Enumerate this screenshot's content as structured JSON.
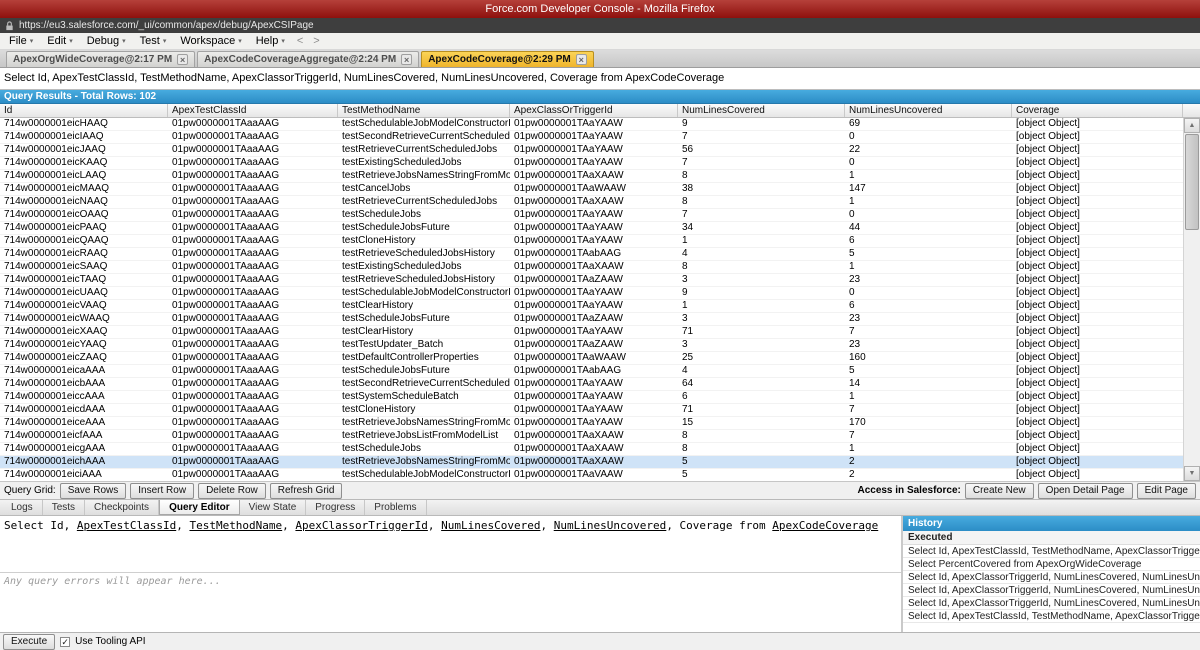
{
  "window": {
    "title": "Force.com Developer Console - Mozilla Firefox",
    "url": "https://eu3.salesforce.com/_ui/common/apex/debug/ApexCSIPage"
  },
  "menu": {
    "items": [
      "File",
      "Edit",
      "Debug",
      "Test",
      "Workspace",
      "Help"
    ],
    "back": "<",
    "forward": ">"
  },
  "tabs": [
    {
      "label": "ApexOrgWideCoverage@2:17 PM",
      "active": false
    },
    {
      "label": "ApexCodeCoverageAggregate@2:24 PM",
      "active": false
    },
    {
      "label": "ApexCodeCoverage@2:29 PM",
      "active": true
    }
  ],
  "query_bar": {
    "text": "Select Id, ApexTestClassId, TestMethodName, ApexClassorTriggerId, NumLinesCovered, NumLinesUncovered, Coverage from ApexCodeCoverage"
  },
  "results": {
    "header": "Query Results - Total Rows: 102",
    "columns": [
      "Id",
      "ApexTestClassId",
      "TestMethodName",
      "ApexClassOrTriggerId",
      "NumLinesCovered",
      "NumLinesUncovered",
      "Coverage"
    ],
    "selected_index": 26,
    "rows": [
      [
        "714w0000001eicHAAQ",
        "01pw0000001TAaaAAG",
        "testSchedulableJobModelConstructorPassNull",
        "01pw0000001TAaYAAW",
        "9",
        "69",
        "[object Object]"
      ],
      [
        "714w0000001eicIAAQ",
        "01pw0000001TAaaAAG",
        "testSecondRetrieveCurrentScheduledJobs",
        "01pw0000001TAaYAAW",
        "7",
        "0",
        "[object Object]"
      ],
      [
        "714w0000001eicJAAQ",
        "01pw0000001TAaaAAG",
        "testRetrieveCurrentScheduledJobs",
        "01pw0000001TAaYAAW",
        "56",
        "22",
        "[object Object]"
      ],
      [
        "714w0000001eicKAAQ",
        "01pw0000001TAaaAAG",
        "testExistingScheduledJobs",
        "01pw0000001TAaYAAW",
        "7",
        "0",
        "[object Object]"
      ],
      [
        "714w0000001eicLAAQ",
        "01pw0000001TAaaAAG",
        "testRetrieveJobsNamesStringFromModelList",
        "01pw0000001TAaXAAW",
        "8",
        "1",
        "[object Object]"
      ],
      [
        "714w0000001eicMAAQ",
        "01pw0000001TAaaAAG",
        "testCancelJobs",
        "01pw0000001TAaWAAW",
        "38",
        "147",
        "[object Object]"
      ],
      [
        "714w0000001eicNAAQ",
        "01pw0000001TAaaAAG",
        "testRetrieveCurrentScheduledJobs",
        "01pw0000001TAaXAAW",
        "8",
        "1",
        "[object Object]"
      ],
      [
        "714w0000001eicOAAQ",
        "01pw0000001TAaaAAG",
        "testScheduleJobs",
        "01pw0000001TAaYAAW",
        "7",
        "0",
        "[object Object]"
      ],
      [
        "714w0000001eicPAAQ",
        "01pw0000001TAaaAAG",
        "testScheduleJobsFuture",
        "01pw0000001TAaYAAW",
        "34",
        "44",
        "[object Object]"
      ],
      [
        "714w0000001eicQAAQ",
        "01pw0000001TAaaAAG",
        "testCloneHistory",
        "01pw0000001TAaYAAW",
        "1",
        "6",
        "[object Object]"
      ],
      [
        "714w0000001eicRAAQ",
        "01pw0000001TAaaAAG",
        "testRetrieveScheduledJobsHistory",
        "01pw0000001TAabAAG",
        "4",
        "5",
        "[object Object]"
      ],
      [
        "714w0000001eicSAAQ",
        "01pw0000001TAaaAAG",
        "testExistingScheduledJobs",
        "01pw0000001TAaXAAW",
        "8",
        "1",
        "[object Object]"
      ],
      [
        "714w0000001eicTAAQ",
        "01pw0000001TAaaAAG",
        "testRetrieveScheduledJobsHistory",
        "01pw0000001TAaZAAW",
        "3",
        "23",
        "[object Object]"
      ],
      [
        "714w0000001eicUAAQ",
        "01pw0000001TAaaAAG",
        "testSchedulableJobModelConstructorPassNull",
        "01pw0000001TAaYAAW",
        "9",
        "0",
        "[object Object]"
      ],
      [
        "714w0000001eicVAAQ",
        "01pw0000001TAaaAAG",
        "testClearHistory",
        "01pw0000001TAaYAAW",
        "1",
        "6",
        "[object Object]"
      ],
      [
        "714w0000001eicWAAQ",
        "01pw0000001TAaaAAG",
        "testScheduleJobsFuture",
        "01pw0000001TAaZAAW",
        "3",
        "23",
        "[object Object]"
      ],
      [
        "714w0000001eicXAAQ",
        "01pw0000001TAaaAAG",
        "testClearHistory",
        "01pw0000001TAaYAAW",
        "71",
        "7",
        "[object Object]"
      ],
      [
        "714w0000001eicYAAQ",
        "01pw0000001TAaaAAG",
        "testTestUpdater_Batch",
        "01pw0000001TAaZAAW",
        "3",
        "23",
        "[object Object]"
      ],
      [
        "714w0000001eicZAAQ",
        "01pw0000001TAaaAAG",
        "testDefaultControllerProperties",
        "01pw0000001TAaWAAW",
        "25",
        "160",
        "[object Object]"
      ],
      [
        "714w0000001eicaAAA",
        "01pw0000001TAaaAAG",
        "testScheduleJobsFuture",
        "01pw0000001TAabAAG",
        "4",
        "5",
        "[object Object]"
      ],
      [
        "714w0000001eicbAAA",
        "01pw0000001TAaaAAG",
        "testSecondRetrieveCurrentScheduledJobs",
        "01pw0000001TAaYAAW",
        "64",
        "14",
        "[object Object]"
      ],
      [
        "714w0000001eiccAAA",
        "01pw0000001TAaaAAG",
        "testSystemScheduleBatch",
        "01pw0000001TAaYAAW",
        "6",
        "1",
        "[object Object]"
      ],
      [
        "714w0000001eicdAAA",
        "01pw0000001TAaaAAG",
        "testCloneHistory",
        "01pw0000001TAaYAAW",
        "71",
        "7",
        "[object Object]"
      ],
      [
        "714w0000001eiceAAA",
        "01pw0000001TAaaAAG",
        "testRetrieveJobsNamesStringFromModelList",
        "01pw0000001TAaYAAW",
        "15",
        "170",
        "[object Object]"
      ],
      [
        "714w0000001eicfAAA",
        "01pw0000001TAaaAAG",
        "testRetrieveJobsListFromModelList",
        "01pw0000001TAaXAAW",
        "8",
        "7",
        "[object Object]"
      ],
      [
        "714w0000001eicgAAA",
        "01pw0000001TAaaAAG",
        "testScheduleJobs",
        "01pw0000001TAaXAAW",
        "8",
        "1",
        "[object Object]"
      ],
      [
        "714w0000001eichAAA",
        "01pw0000001TAaaAAG",
        "testRetrieveJobsNamesStringFromModelList",
        "01pw0000001TAaXAAW",
        "5",
        "2",
        "[object Object]"
      ],
      [
        "714w0000001eiciAAA",
        "01pw0000001TAaaAAG",
        "testSchedulableJobModelConstructorPassNull",
        "01pw0000001TAaVAAW",
        "5",
        "2",
        "[object Object]"
      ]
    ]
  },
  "grid_toolbar": {
    "label": "Query Grid:",
    "buttons": [
      "Save Rows",
      "Insert Row",
      "Delete Row",
      "Refresh Grid"
    ],
    "access_label": "Access in Salesforce:",
    "access_buttons": [
      "Create New",
      "Open Detail Page",
      "Edit Page"
    ]
  },
  "panel_tabs": [
    {
      "label": "Logs",
      "active": false
    },
    {
      "label": "Tests",
      "active": false
    },
    {
      "label": "Checkpoints",
      "active": false
    },
    {
      "label": "Query Editor",
      "active": true
    },
    {
      "label": "View State",
      "active": false
    },
    {
      "label": "Progress",
      "active": false
    },
    {
      "label": "Problems",
      "active": false
    }
  ],
  "editor": {
    "segments": [
      {
        "text": "Select Id, ",
        "link": false
      },
      {
        "text": "ApexTestClassId",
        "link": true
      },
      {
        "text": ", ",
        "link": false
      },
      {
        "text": "TestMethodName",
        "link": true
      },
      {
        "text": ", ",
        "link": false
      },
      {
        "text": "ApexClassorTriggerId",
        "link": true
      },
      {
        "text": ", ",
        "link": false
      },
      {
        "text": "NumLinesCovered",
        "link": true
      },
      {
        "text": ", ",
        "link": false
      },
      {
        "text": "NumLinesUncovered",
        "link": true
      },
      {
        "text": ", Coverage from ",
        "link": false
      },
      {
        "text": "ApexCodeCoverage",
        "link": true
      }
    ],
    "errors_placeholder": "Any query errors will appear here..."
  },
  "history": {
    "title": "History",
    "section": "Executed",
    "items": [
      "Select Id, ApexTestClassId, TestMethodName, ApexClassorTriggerId, NumLinesCovered, N...",
      "Select PercentCovered from ApexOrgWideCoverage",
      "Select Id, ApexClassorTriggerId, NumLinesCovered, NumLinesUncovered, Coverage from Ape...",
      "Select Id, ApexClassorTriggerId, NumLinesCovered, NumLinesUncovered, Coverage from Ape...",
      "Select Id, ApexClassorTriggerId, NumLinesCovered, NumLinesUncovered, Coverage from Ape...",
      "Select Id, ApexTestClassId, TestMethodName, ApexClassorTriggerId, NumLinesCovered, N..."
    ]
  },
  "statusbar": {
    "execute": "Execute",
    "tooling_label": "Use Tooling API",
    "tooling_checked": true
  },
  "colors": {
    "titlebar_red": "#9b1310",
    "accent_blue": "#2f8fc8",
    "active_tab_gold": "#f2bf49",
    "selection_blue": "#cfe3f7"
  }
}
